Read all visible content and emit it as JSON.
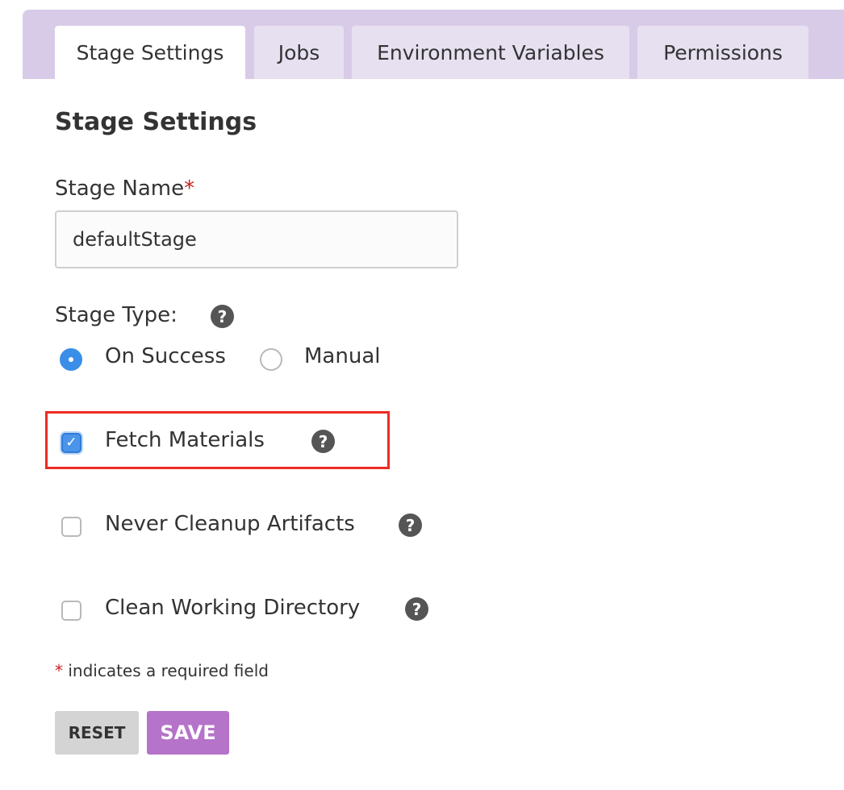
{
  "tabs": [
    {
      "label": "Stage Settings",
      "active": true
    },
    {
      "label": "Jobs",
      "active": false
    },
    {
      "label": "Environment Variables",
      "active": false
    },
    {
      "label": "Permissions",
      "active": false
    }
  ],
  "section_title": "Stage Settings",
  "stage_name": {
    "label": "Stage Name",
    "required_marker": "*",
    "value": "defaultStage"
  },
  "stage_type": {
    "label": "Stage Type:",
    "help_glyph": "?",
    "options": [
      {
        "label": "On Success",
        "selected": true
      },
      {
        "label": "Manual",
        "selected": false
      }
    ]
  },
  "checkboxes": [
    {
      "label": "Fetch Materials",
      "checked": true,
      "help_glyph": "?",
      "highlighted": true
    },
    {
      "label": "Never Cleanup Artifacts",
      "checked": false,
      "help_glyph": "?"
    },
    {
      "label": "Clean Working Directory",
      "checked": false,
      "help_glyph": "?"
    }
  ],
  "footnote": {
    "marker": "*",
    "text": " indicates a required field"
  },
  "buttons": {
    "reset": "RESET",
    "save": "SAVE"
  },
  "colors": {
    "tabbar_bg": "#d8cbe8",
    "tab_bg": "#e7e0f1",
    "accent_blue": "#3b8ee8",
    "required_red": "#cc1f1f",
    "highlight_red": "#ee2b22",
    "save_purple": "#b573c9",
    "reset_gray": "#d4d4d4"
  },
  "icons": {
    "help": "help-icon",
    "check": "check-icon"
  }
}
